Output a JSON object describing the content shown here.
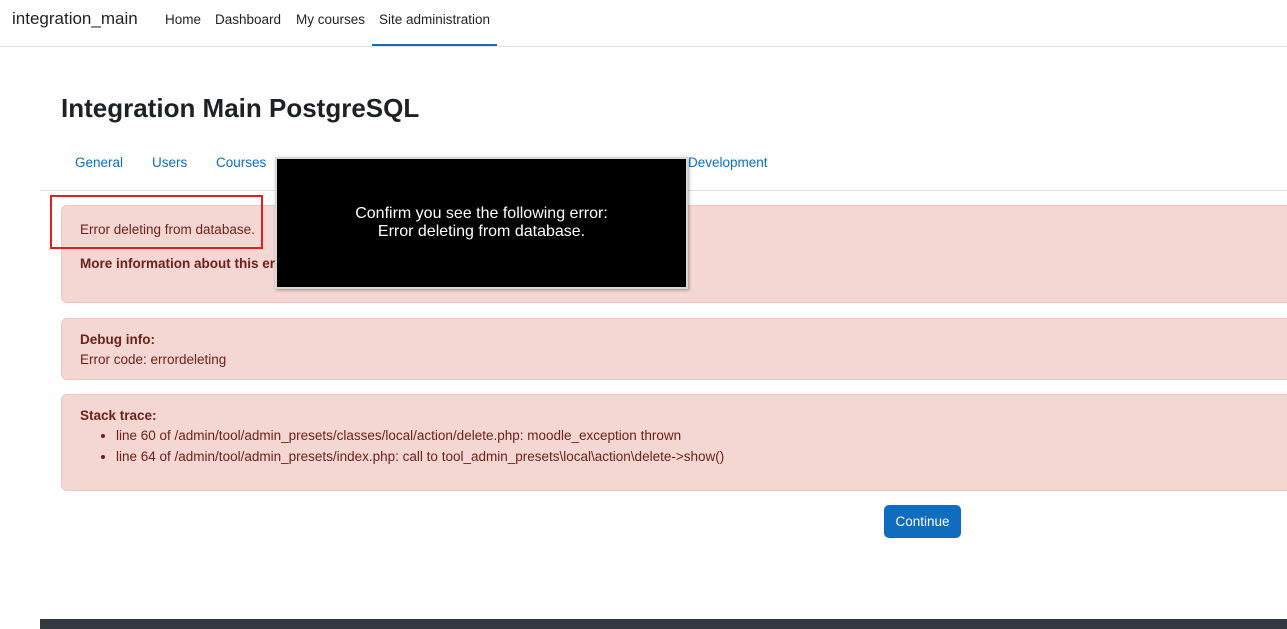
{
  "navbar": {
    "brand": "integration_main",
    "items": [
      {
        "label": "Home"
      },
      {
        "label": "Dashboard"
      },
      {
        "label": "My courses"
      },
      {
        "label": "Site administration",
        "active": true
      }
    ]
  },
  "page": {
    "title": "Integration Main PostgreSQL"
  },
  "tabs": [
    {
      "label": "General"
    },
    {
      "label": "Users"
    },
    {
      "label": "Courses"
    },
    {
      "label": "Development"
    }
  ],
  "error_alert": {
    "message": "Error deleting from database.",
    "more_info": "More information about this er"
  },
  "debug_alert": {
    "heading": "Debug info:",
    "code": "Error code: errordeleting"
  },
  "stack_alert": {
    "heading": "Stack trace:",
    "lines": [
      "line 60 of /admin/tool/admin_presets/classes/local/action/delete.php: moodle_exception thrown",
      "line 64 of /admin/tool/admin_presets/index.php: call to tool_admin_presets\\local\\action\\delete->show()"
    ]
  },
  "overlay": {
    "line1": "Confirm you see the following error:",
    "line2": "Error deleting from database."
  },
  "continue_label": "Continue",
  "colors": {
    "accent": "#0f6cbf",
    "alert_bg": "#f4d6d2",
    "alert_text": "#6e211a",
    "highlight": "#e02020",
    "footer": "#343a40"
  }
}
